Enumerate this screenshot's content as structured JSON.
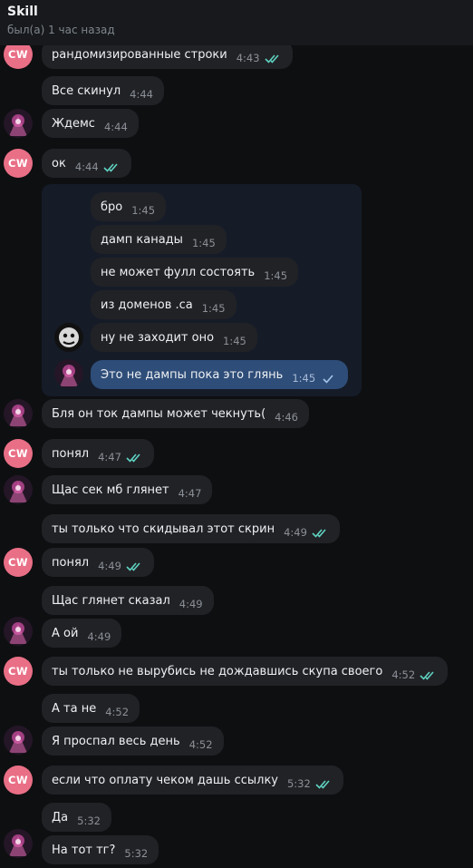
{
  "header": {
    "title": "Skill",
    "status": "был(а) 1 час назад"
  },
  "avatar_cw_label": "CW",
  "messages": [
    {
      "text": "рандомизированные строки",
      "time": "4:43"
    },
    {
      "text": "Все скинул",
      "time": "4:44"
    },
    {
      "text": "Ждемс",
      "time": "4:44"
    },
    {
      "text": "ок",
      "time": "4:44"
    },
    {
      "text": "бро",
      "time": "1:45"
    },
    {
      "text": "дамп канады",
      "time": "1:45"
    },
    {
      "text": "не может фулл состоять",
      "time": "1:45"
    },
    {
      "text": "из доменов .ca",
      "time": "1:45"
    },
    {
      "text": "ну не заходит оно",
      "time": "1:45"
    },
    {
      "text": "Это не дампы пока это глянь",
      "time": "1:45"
    },
    {
      "text": "Бля он ток дампы может чекнуть(",
      "time": "4:46"
    },
    {
      "text": "понял",
      "time": "4:47"
    },
    {
      "text": "Щас сек мб глянет",
      "time": "4:47"
    },
    {
      "text": "ты только что скидывал этот скрин",
      "time": "4:49"
    },
    {
      "text": "понял",
      "time": "4:49"
    },
    {
      "text": "Щас глянет сказал",
      "time": "4:49"
    },
    {
      "text": "А ой",
      "time": "4:49"
    },
    {
      "text": "ты только не вырубись не дождавшись скупа своего",
      "time": "4:52"
    },
    {
      "text": "А та не",
      "time": "4:52"
    },
    {
      "text": "Я проспал весь день",
      "time": "4:52"
    },
    {
      "text": "если что оплату чеком дашь ссылку",
      "time": "5:32"
    },
    {
      "text": "Да",
      "time": "5:32"
    },
    {
      "text": "На тот тг?",
      "time": "5:32"
    }
  ]
}
